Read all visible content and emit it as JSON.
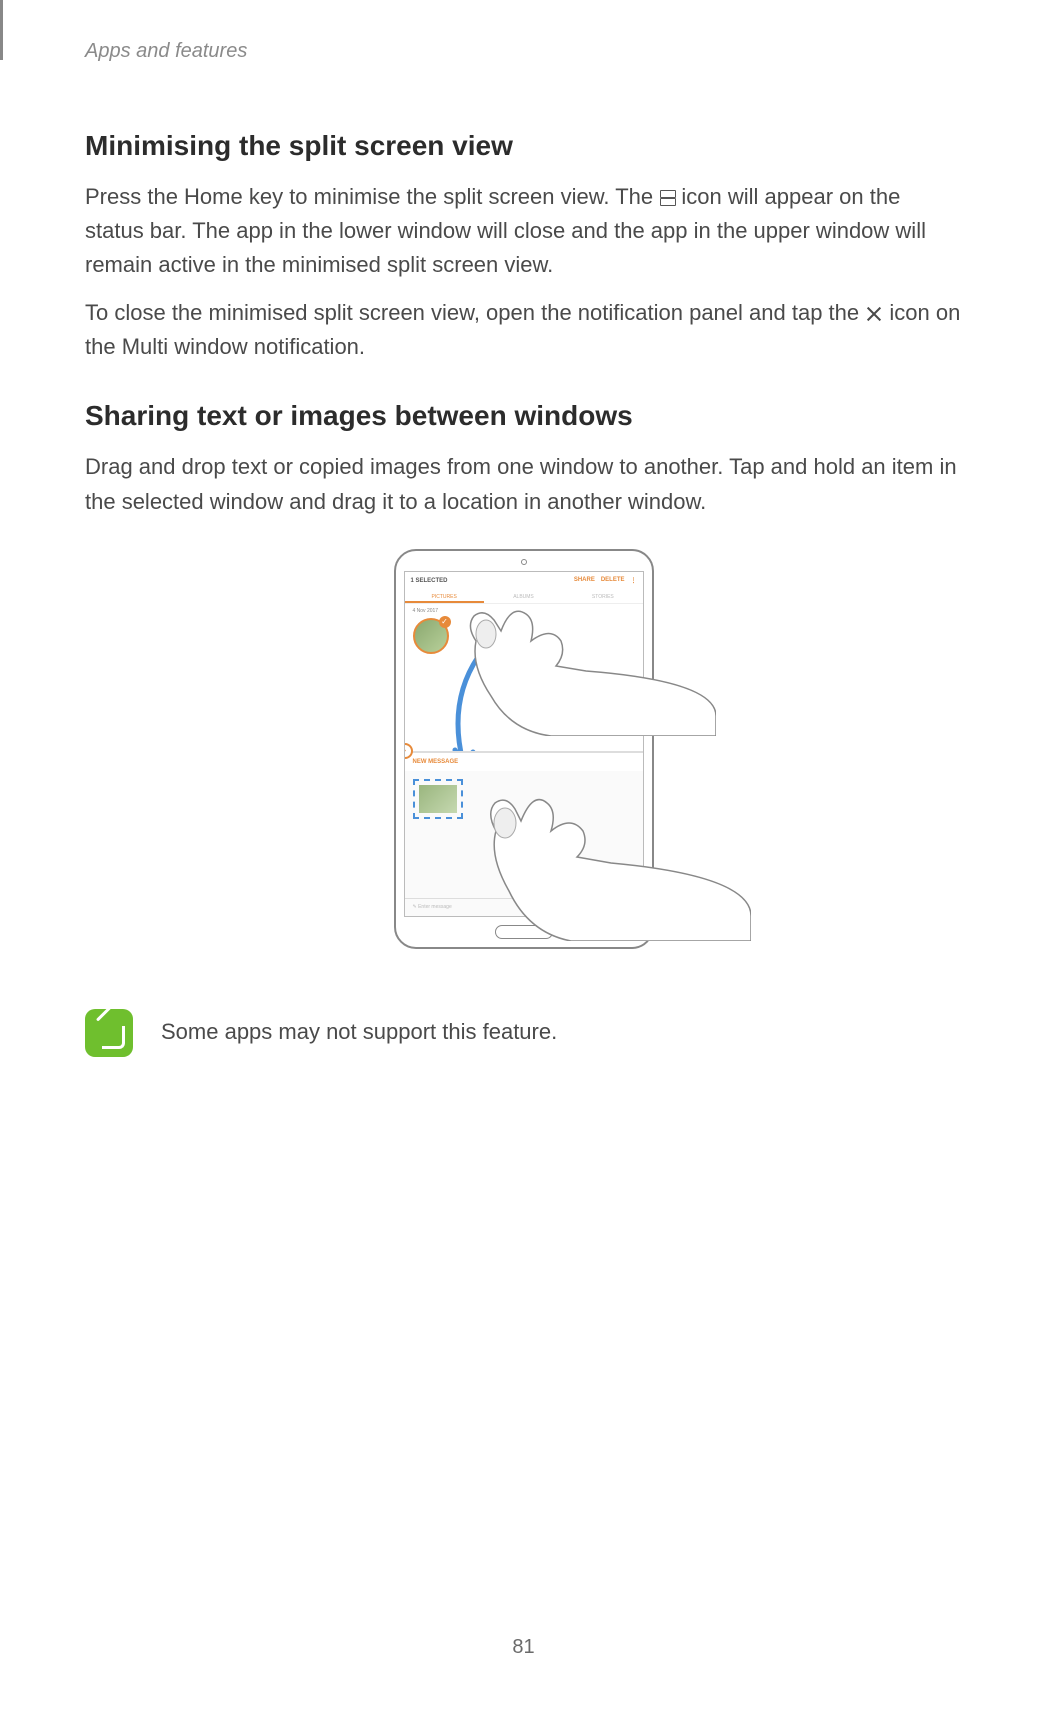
{
  "breadcrumb": "Apps and features",
  "section1": {
    "title": "Minimising the split screen view",
    "p1a": "Press the Home key to minimise the split screen view. The ",
    "p1b": " icon will appear on the status bar. The app in the lower window will close and the app in the upper window will remain active in the minimised split screen view.",
    "p2a": "To close the minimised split screen view, open the notification panel and tap the ",
    "p2b": " icon on the Multi window notification."
  },
  "section2": {
    "title": "Sharing text or images between windows",
    "p1": "Drag and drop text or copied images from one window to another. Tap and hold an item in the selected window and drag it to a location in another window."
  },
  "device": {
    "selected_label": "1 SELECTED",
    "action_share": "SHARE",
    "action_delete": "DELETE",
    "tab_pictures": "PICTURES",
    "tab_albums": "ALBUMS",
    "tab_stories": "STORIES",
    "date": "4 Nov 2017",
    "new_message": "NEW MESSAGE",
    "enter_message": "Enter message"
  },
  "note": "Some apps may not support this feature.",
  "page_number": "81"
}
